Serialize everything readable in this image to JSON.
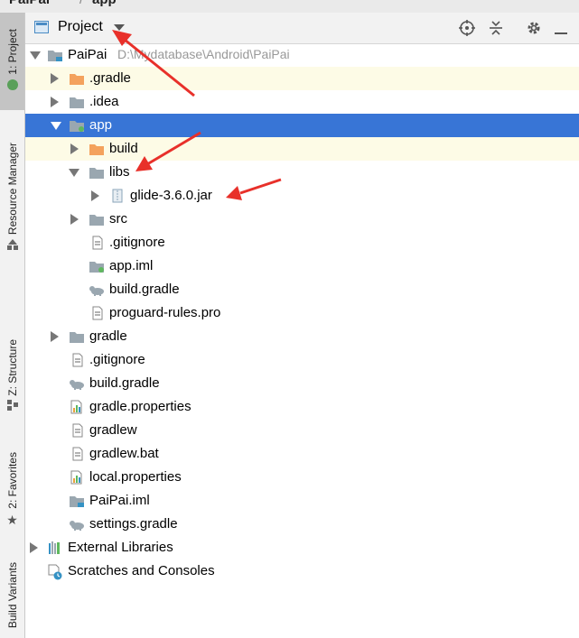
{
  "topbar": {
    "project_name": "PaiPai",
    "module_name": "app"
  },
  "sidebar": {
    "tabs": [
      {
        "label": "1: Project",
        "icon": "android-icon",
        "active": true
      },
      {
        "label": "Resource Manager",
        "icon": "resource-icon"
      },
      {
        "label": "Z: Structure",
        "icon": "structure-icon"
      },
      {
        "label": "2: Favorites",
        "icon": "star-icon"
      },
      {
        "label": "Build Variants",
        "icon": ""
      }
    ]
  },
  "header": {
    "title": "Project"
  },
  "tree": [
    {
      "label": "PaiPai",
      "path": "D:\\Mydatabase\\Android\\PaiPai",
      "icon": "module-folder-icon",
      "expanded": true
    },
    {
      "label": ".gradle",
      "icon": "folder-orange-icon"
    },
    {
      "label": ".idea",
      "icon": "folder-icon"
    },
    {
      "label": "app",
      "icon": "module-folder-icon",
      "expanded": true,
      "selected": true
    },
    {
      "label": "build",
      "icon": "folder-orange-icon"
    },
    {
      "label": "libs",
      "icon": "folder-icon",
      "expanded": true
    },
    {
      "label": "glide-3.6.0.jar",
      "icon": "jar-icon"
    },
    {
      "label": "src",
      "icon": "folder-icon"
    },
    {
      "label": ".gitignore",
      "icon": "text-file-icon"
    },
    {
      "label": "app.iml",
      "icon": "iml-icon"
    },
    {
      "label": "build.gradle",
      "icon": "gradle-icon"
    },
    {
      "label": "proguard-rules.pro",
      "icon": "text-file-icon"
    },
    {
      "label": "gradle",
      "icon": "folder-icon"
    },
    {
      "label": ".gitignore",
      "icon": "text-file-icon"
    },
    {
      "label": "build.gradle",
      "icon": "gradle-icon"
    },
    {
      "label": "gradle.properties",
      "icon": "properties-icon"
    },
    {
      "label": "gradlew",
      "icon": "text-file-icon"
    },
    {
      "label": "gradlew.bat",
      "icon": "text-file-icon"
    },
    {
      "label": "local.properties",
      "icon": "properties-icon"
    },
    {
      "label": "PaiPai.iml",
      "icon": "iml-icon"
    },
    {
      "label": "settings.gradle",
      "icon": "gradle-icon"
    },
    {
      "label": "External Libraries",
      "icon": "libraries-icon"
    },
    {
      "label": "Scratches and Consoles",
      "icon": "scratches-icon"
    }
  ],
  "colors": {
    "selection": "#3875d6",
    "highlight": "#fdfbe6",
    "annotation_arrow": "#e8302a"
  }
}
